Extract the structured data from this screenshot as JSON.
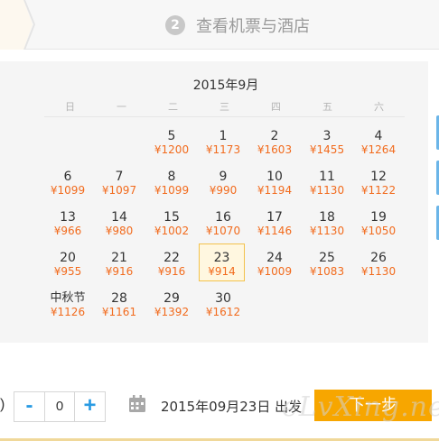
{
  "step": {
    "number": "2",
    "label": "查看机票与酒店"
  },
  "calendar": {
    "title": "2015年9月",
    "weekdays": [
      "日",
      "一",
      "二",
      "三",
      "四",
      "五",
      "六"
    ],
    "weeks": [
      [
        null,
        null,
        null,
        {
          "day": "1",
          "price": "¥1173"
        },
        {
          "day": "2",
          "price": "¥1603"
        },
        {
          "day": "3",
          "price": "¥1455"
        },
        {
          "day": "4",
          "price": "¥1264"
        },
        {
          "day": "5",
          "price": "¥1200"
        }
      ],
      [
        {
          "day": "6",
          "price": "¥1099"
        },
        {
          "day": "7",
          "price": "¥1097"
        },
        {
          "day": "8",
          "price": "¥1099"
        },
        {
          "day": "9",
          "price": "¥990"
        },
        {
          "day": "10",
          "price": "¥1194"
        },
        {
          "day": "11",
          "price": "¥1130"
        },
        {
          "day": "12",
          "price": "¥1122"
        }
      ],
      [
        {
          "day": "13",
          "price": "¥966"
        },
        {
          "day": "14",
          "price": "¥980"
        },
        {
          "day": "15",
          "price": "¥1002"
        },
        {
          "day": "16",
          "price": "¥1070"
        },
        {
          "day": "17",
          "price": "¥1146"
        },
        {
          "day": "18",
          "price": "¥1130"
        },
        {
          "day": "19",
          "price": "¥1050"
        }
      ],
      [
        {
          "day": "20",
          "price": "¥955"
        },
        {
          "day": "21",
          "price": "¥916"
        },
        {
          "day": "22",
          "price": "¥916"
        },
        {
          "day": "23",
          "price": "¥914",
          "selected": true
        },
        {
          "day": "24",
          "price": "¥1009"
        },
        {
          "day": "25",
          "price": "¥1083"
        },
        {
          "day": "26",
          "price": "¥1130"
        }
      ],
      [
        {
          "day": "中秋节",
          "price": "¥1126",
          "holiday": true
        },
        {
          "day": "28",
          "price": "¥1161"
        },
        {
          "day": "29",
          "price": "¥1392"
        },
        {
          "day": "30",
          "price": "¥1612"
        }
      ]
    ]
  },
  "bottom": {
    "paren": ")",
    "minus": "-",
    "quantity": "0",
    "plus": "+",
    "date_text": "2015年09月23日 出发",
    "next_label": "下一步",
    "watermark": "eLvXing.net"
  },
  "colors": {
    "accent": "#f7a600",
    "price": "#f26b1d",
    "stepper": "#2a9be3"
  },
  "icons": {
    "calendar": "calendar-icon",
    "step_number": "step-number-badge"
  }
}
